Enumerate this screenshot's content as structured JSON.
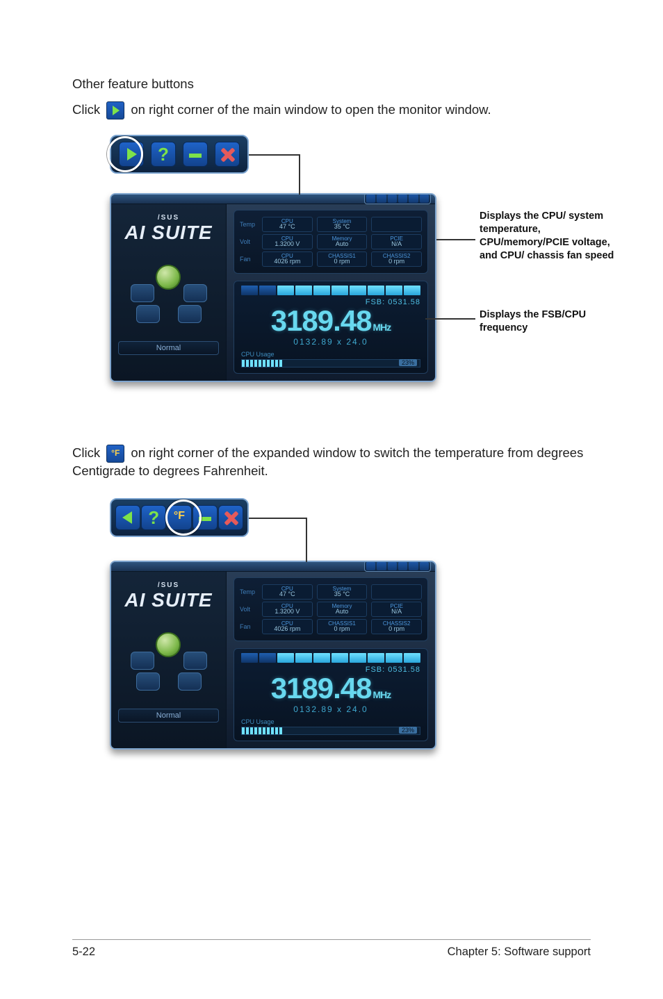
{
  "heading": "Other feature buttons",
  "para1_a": "Click",
  "para1_b": "on right corner of the main window to open the monitor window.",
  "para2_a": "Click",
  "para2_b": "on right corner of the expanded window to switch the temperature from degrees Centigrade to degrees Fahrenheit.",
  "callouts": {
    "monitor": "Displays the CPU/ system temperature, CPU/memory/PCIE voltage, and CPU/ chassis fan speed",
    "freq": "Displays the FSB/CPU frequency"
  },
  "suite": {
    "brand_small": "/SUS",
    "brand_big": "AI SUITE",
    "mode": "Normal",
    "monitor": {
      "rows": [
        {
          "label": "Temp",
          "chips": [
            {
              "title": "CPU",
              "value": "47 °C",
              "pct": 35
            },
            {
              "title": "System",
              "value": "35 °C",
              "pct": 25
            },
            {
              "title": "",
              "value": "",
              "pct": 0
            }
          ]
        },
        {
          "label": "Volt",
          "chips": [
            {
              "title": "CPU",
              "value": "1.3200 V",
              "pct": 40
            },
            {
              "title": "Memory",
              "value": "Auto",
              "pct": 30
            },
            {
              "title": "PCIE",
              "value": "N/A",
              "pct": 0
            }
          ]
        },
        {
          "label": "Fan",
          "chips": [
            {
              "title": "CPU",
              "value": "4026 rpm",
              "pct": 55
            },
            {
              "title": "CHASSIS1",
              "value": "0 rpm",
              "pct": 0
            },
            {
              "title": "CHASSIS2",
              "value": "0 rpm",
              "pct": 0
            }
          ]
        }
      ]
    },
    "freq": {
      "fsb_label": "FSB:",
      "fsb_value": "0531.58",
      "main": "3189.48",
      "unit": "MHz",
      "mult": "0132.89  x  24.0",
      "usage_label": "CPU Usage",
      "usage_pct": "23%",
      "usage_fill": 23
    }
  },
  "footer": {
    "left": "5-22",
    "right": "Chapter 5: Software support"
  }
}
